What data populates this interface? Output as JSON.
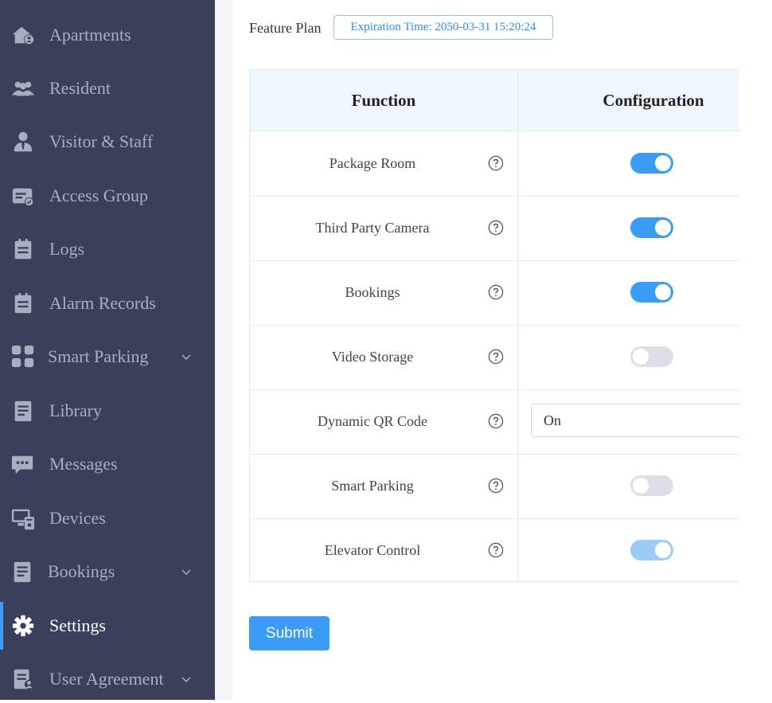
{
  "sidebar": {
    "items": [
      {
        "label": "Apartments",
        "icon": "home-user-icon"
      },
      {
        "label": "Resident",
        "icon": "users-icon"
      },
      {
        "label": "Visitor & Staff",
        "icon": "staff-icon"
      },
      {
        "label": "Access Group",
        "icon": "access-card-icon"
      },
      {
        "label": "Logs",
        "icon": "clipboard-icon"
      },
      {
        "label": "Alarm Records",
        "icon": "clipboard-icon"
      },
      {
        "label": "Smart Parking",
        "icon": "grid-icon",
        "expandable": true
      },
      {
        "label": "Library",
        "icon": "document-icon"
      },
      {
        "label": "Messages",
        "icon": "chat-icon"
      },
      {
        "label": "Devices",
        "icon": "devices-icon"
      },
      {
        "label": "Bookings",
        "icon": "list-document-icon",
        "expandable": true
      },
      {
        "label": "Settings",
        "icon": "gear-icon",
        "active": true
      },
      {
        "label": "User Agreement",
        "icon": "agreement-icon",
        "expandable": true
      }
    ],
    "colors": {
      "background": "#3a3f5c",
      "text": "#a9aec1",
      "active_text": "#ffffff",
      "accent": "#3a9cf6"
    }
  },
  "feature_plan": {
    "label": "Feature Plan",
    "expiration": "Expiration Time: 2050-03-31 15:20:24"
  },
  "table": {
    "headers": {
      "function": "Function",
      "configuration": "Configuration"
    },
    "rows": [
      {
        "function": "Package Room",
        "control": "toggle",
        "on": true
      },
      {
        "function": "Third Party Camera",
        "control": "toggle",
        "on": true
      },
      {
        "function": "Bookings",
        "control": "toggle",
        "on": true
      },
      {
        "function": "Video Storage",
        "control": "toggle",
        "on": false
      },
      {
        "function": "Dynamic QR Code",
        "control": "select",
        "value": "On"
      },
      {
        "function": "Smart Parking",
        "control": "toggle",
        "on": false
      },
      {
        "function": "Elevator Control",
        "control": "toggle",
        "on": true,
        "disabled": true
      }
    ]
  },
  "submit_label": "Submit"
}
